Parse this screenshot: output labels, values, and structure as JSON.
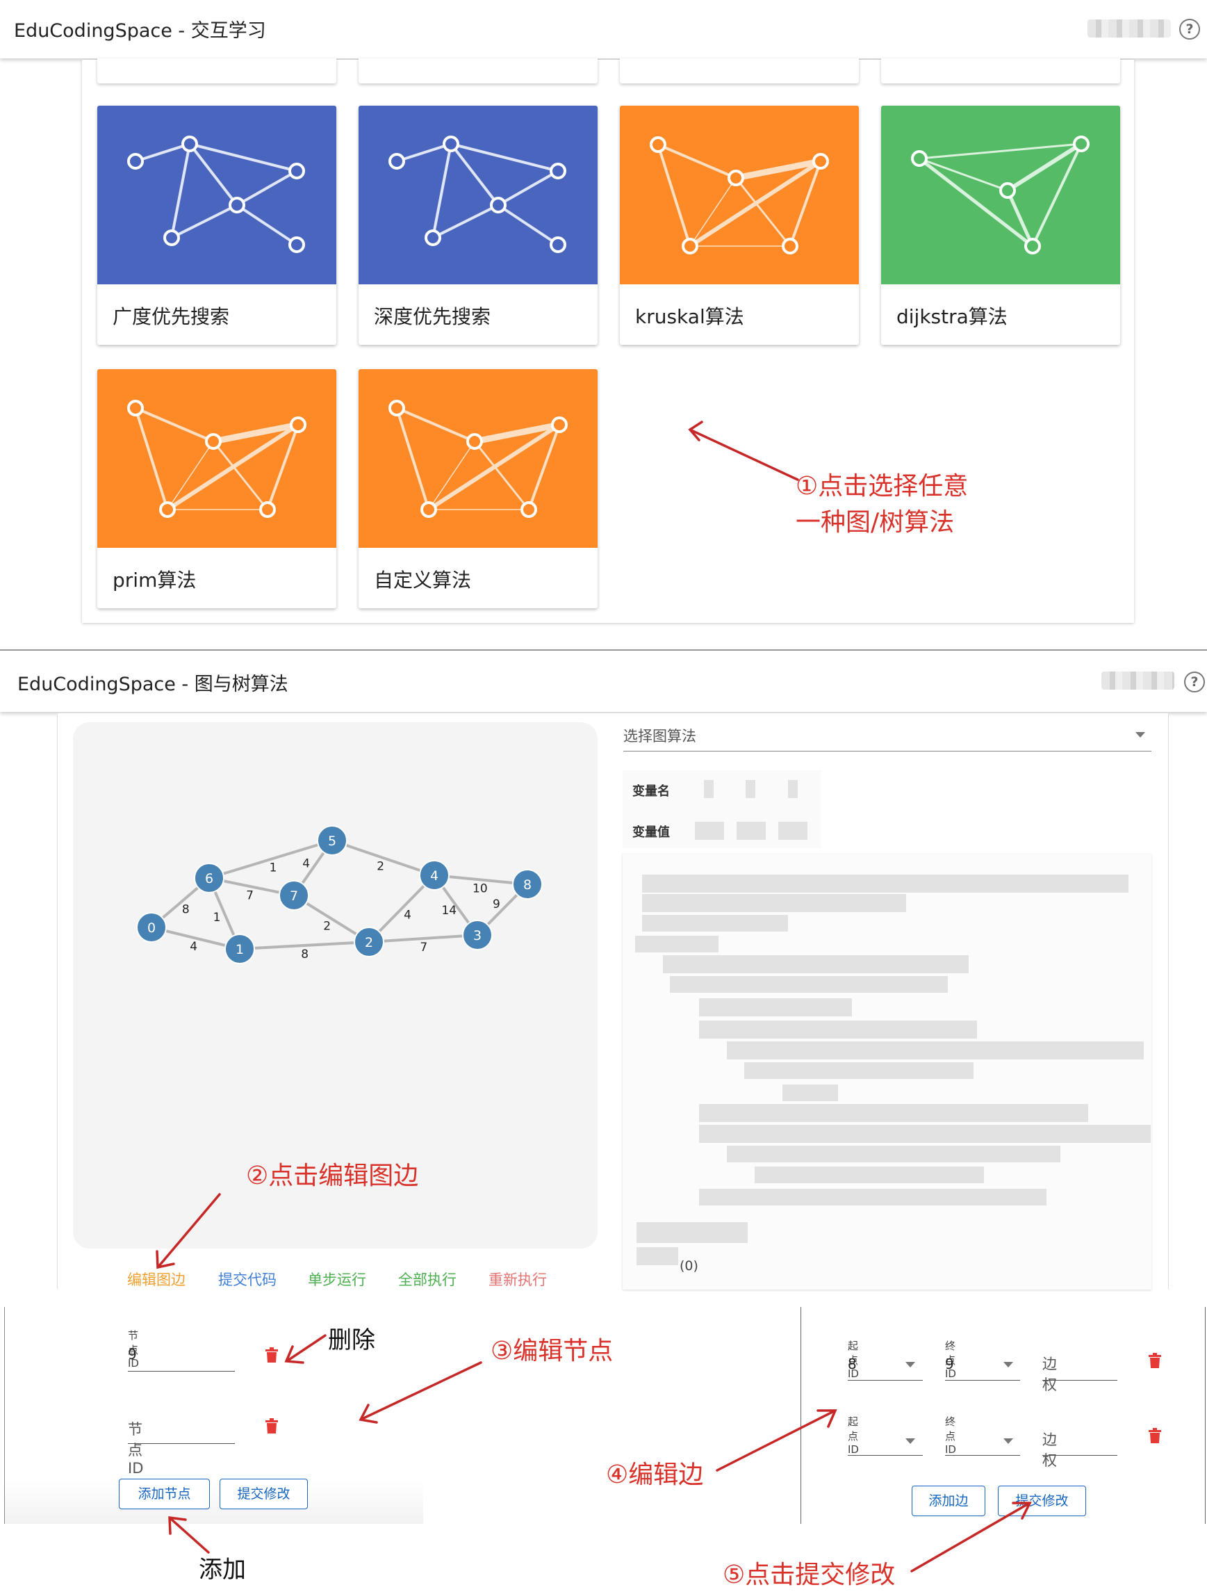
{
  "top_window": {
    "title": "EduCodingSpace - 交互学习",
    "cards": [
      {
        "label": "广度优先搜索",
        "icon": "graph-network-icon",
        "color": "#4a65bd"
      },
      {
        "label": "深度优先搜索",
        "icon": "graph-network-icon",
        "color": "#4a65bd"
      },
      {
        "label": "kruskal算法",
        "icon": "spanning-tree-icon",
        "color": "#fd8a27"
      },
      {
        "label": "dijkstra算法",
        "icon": "directed-graph-icon",
        "color": "#55bb66"
      },
      {
        "label": "prim算法",
        "icon": "spanning-tree-icon",
        "color": "#fd8a27"
      },
      {
        "label": "自定义算法",
        "icon": "spanning-tree-icon",
        "color": "#fd8a27"
      }
    ]
  },
  "annotations": {
    "step1_line1": "①点击选择任意",
    "step1_line2": "一种图/树算法",
    "step2": "②点击编辑图边",
    "step3": "③编辑节点",
    "step4": "④编辑边",
    "step5": "⑤点击提交修改",
    "delete": "删除",
    "add": "添加"
  },
  "bottom_window": {
    "title": "EduCodingSpace - 图与树算法",
    "select_placeholder": "选择图算法",
    "var_name_label": "变量名",
    "var_value_label": "变量值",
    "code_footer": "(0)",
    "graph": {
      "nodes": [
        "0",
        "1",
        "2",
        "3",
        "4",
        "5",
        "6",
        "7",
        "8"
      ],
      "edges": [
        {
          "from": "0",
          "to": "6",
          "w": "8"
        },
        {
          "from": "0",
          "to": "1",
          "w": "4"
        },
        {
          "from": "6",
          "to": "1",
          "w": "1"
        },
        {
          "from": "6",
          "to": "5",
          "w": "1"
        },
        {
          "from": "6",
          "to": "7",
          "w": "7"
        },
        {
          "from": "5",
          "to": "7",
          "w": "4"
        },
        {
          "from": "5",
          "to": "4",
          "w": "2"
        },
        {
          "from": "7",
          "to": "2",
          "w": "2"
        },
        {
          "from": "1",
          "to": "2",
          "w": "8"
        },
        {
          "from": "2",
          "to": "4",
          "w": "4"
        },
        {
          "from": "2",
          "to": "3",
          "w": "7"
        },
        {
          "from": "4",
          "to": "3",
          "w": "14"
        },
        {
          "from": "4",
          "to": "8",
          "w": "10"
        },
        {
          "from": "8",
          "to": "3",
          "w": "9"
        }
      ],
      "node_color": "#4682b4"
    },
    "controls": [
      {
        "label": "编辑图边",
        "color": "#f0a030"
      },
      {
        "label": "提交代码",
        "color": "#3f7fd9"
      },
      {
        "label": "单步运行",
        "color": "#4caf50"
      },
      {
        "label": "全部执行",
        "color": "#4caf50"
      },
      {
        "label": "重新执行",
        "color": "#e57373"
      }
    ]
  },
  "node_editor": {
    "field_label": "节点ID",
    "row1_value": "9",
    "row2_placeholder": "节点ID",
    "add_button": "添加节点",
    "submit_button": "提交修改"
  },
  "edge_editor": {
    "start_label": "起点ID",
    "end_label": "终点ID",
    "weight_placeholder": "边权",
    "row1_start": "8",
    "row1_end": "9",
    "add_button": "添加边",
    "submit_button": "提交修改"
  }
}
